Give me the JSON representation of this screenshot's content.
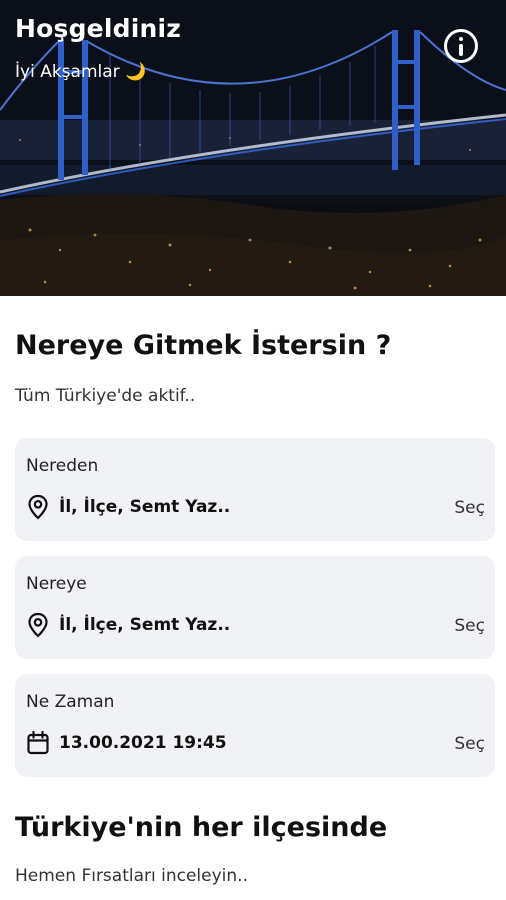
{
  "hero": {
    "title": "Hoşgeldiniz",
    "greeting": "İyi Akşamlar 🌙"
  },
  "section1": {
    "title": "Nereye Gitmek İstersin ?",
    "subtitle": "Tüm Türkiye'de aktif.."
  },
  "from": {
    "label": "Nereden",
    "placeholder": "İl, İlçe, Semt Yaz..",
    "action": "Seç",
    "icon": "location-pin-icon"
  },
  "to": {
    "label": "Nereye",
    "placeholder": "İl, İlçe, Semt Yaz..",
    "action": "Seç",
    "icon": "location-pin-icon"
  },
  "when": {
    "label": "Ne Zaman",
    "value": "13.00.2021 19:45",
    "action": "Seç",
    "icon": "calendar-icon"
  },
  "section2": {
    "title": "Türkiye'nin her ilçesinde",
    "subtitle": "Hemen Fırsatları inceleyin.."
  },
  "colors": {
    "card_bg": "#f1f2f6",
    "bridge_light": "#3a78ff"
  }
}
